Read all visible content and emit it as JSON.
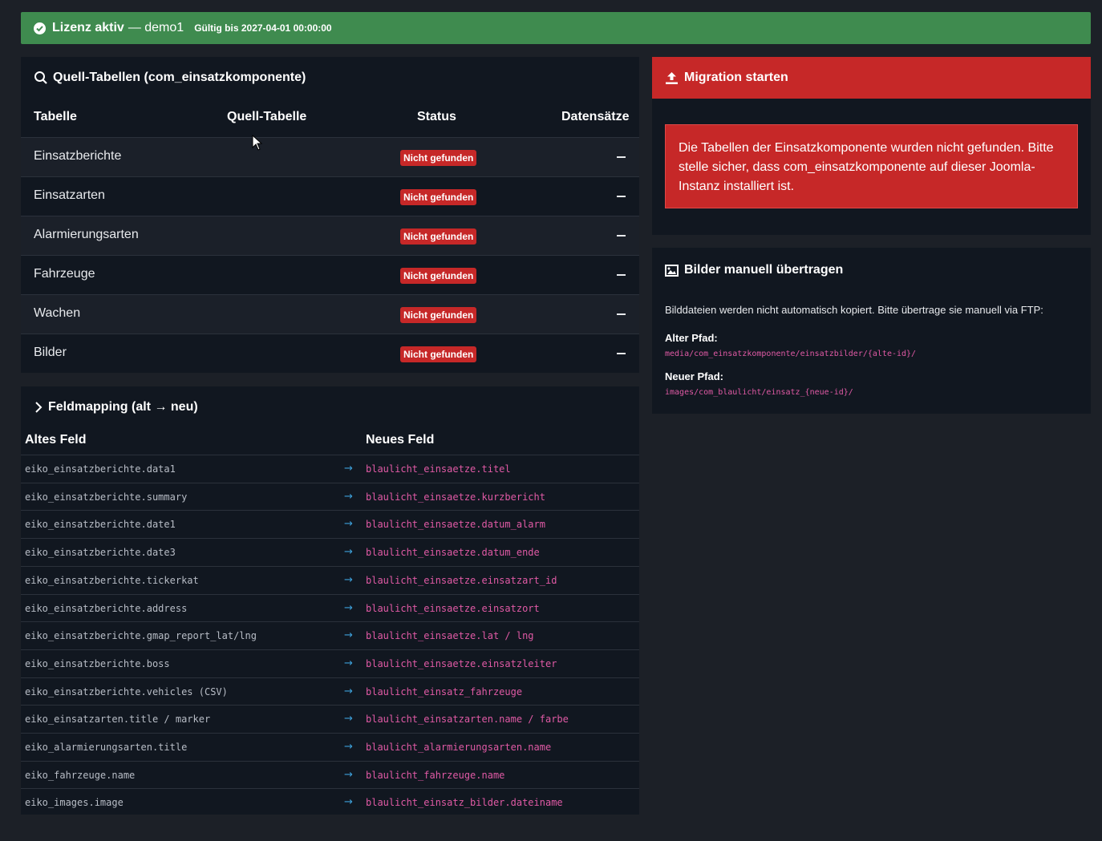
{
  "license": {
    "title": "Lizenz aktiv",
    "user": "— demo1",
    "valid": "Gültig bis 2027-04-01 00:00:00",
    "color": "#3f8b4f"
  },
  "source": {
    "title": "Quell-Tabellen (com_einsatzkomponente)",
    "columns": [
      "Tabelle",
      "Quell-Tabelle",
      "Status",
      "Datensätze"
    ],
    "rows": [
      {
        "name": "Einsatzberichte",
        "status": "Nicht gefunden"
      },
      {
        "name": "Einsatzarten",
        "status": "Nicht gefunden"
      },
      {
        "name": "Alarmierungsarten",
        "status": "Nicht gefunden"
      },
      {
        "name": "Fahrzeuge",
        "status": "Nicht gefunden"
      },
      {
        "name": "Wachen",
        "status": "Nicht gefunden"
      },
      {
        "name": "Bilder",
        "status": "Nicht gefunden"
      }
    ]
  },
  "mapping": {
    "title": "Feldmapping (alt → neu)",
    "columns": [
      "Altes Feld",
      "Neues Feld"
    ],
    "rows": [
      {
        "old": "eiko_einsatzberichte.data1",
        "new": "blaulicht_einsaetze.titel"
      },
      {
        "old": "eiko_einsatzberichte.summary",
        "new": "blaulicht_einsaetze.kurzbericht"
      },
      {
        "old": "eiko_einsatzberichte.date1",
        "new": "blaulicht_einsaetze.datum_alarm"
      },
      {
        "old": "eiko_einsatzberichte.date3",
        "new": "blaulicht_einsaetze.datum_ende"
      },
      {
        "old": "eiko_einsatzberichte.tickerkat",
        "new": "blaulicht_einsaetze.einsatzart_id"
      },
      {
        "old": "eiko_einsatzberichte.address",
        "new": "blaulicht_einsaetze.einsatzort"
      },
      {
        "old": "eiko_einsatzberichte.gmap_report_lat/lng",
        "new": "blaulicht_einsaetze.lat / lng"
      },
      {
        "old": "eiko_einsatzberichte.boss",
        "new": "blaulicht_einsaetze.einsatzleiter"
      },
      {
        "old": "eiko_einsatzberichte.vehicles (CSV)",
        "new": "blaulicht_einsatz_fahrzeuge"
      },
      {
        "old": "eiko_einsatzarten.title / marker",
        "new": "blaulicht_einsatzarten.name / farbe"
      },
      {
        "old": "eiko_alarmierungsarten.title",
        "new": "blaulicht_alarmierungsarten.name"
      },
      {
        "old": "eiko_fahrzeuge.name",
        "new": "blaulicht_fahrzeuge.name"
      },
      {
        "old": "eiko_images.image",
        "new": "blaulicht_einsatz_bilder.dateiname"
      }
    ]
  },
  "migration": {
    "title": "Migration starten",
    "alert": "Die Tabellen der Einsatzkomponente wurden nicht gefunden. Bitte stelle sicher, dass com_einsatzkomponente auf dieser Joomla-Instanz installiert ist.",
    "color": "#c62828"
  },
  "images": {
    "title": "Bilder manuell übertragen",
    "desc": "Bilddateien werden nicht automatisch kopiert. Bitte übertrage sie manuell via FTP:",
    "old_label": "Alter Pfad:",
    "old_path": "media/com_einsatzkomponente/einsatzbilder/{alte-id}/",
    "new_label": "Neuer Pfad:",
    "new_path": "images/com_blaulicht/einsatz_{neue-id}/"
  }
}
